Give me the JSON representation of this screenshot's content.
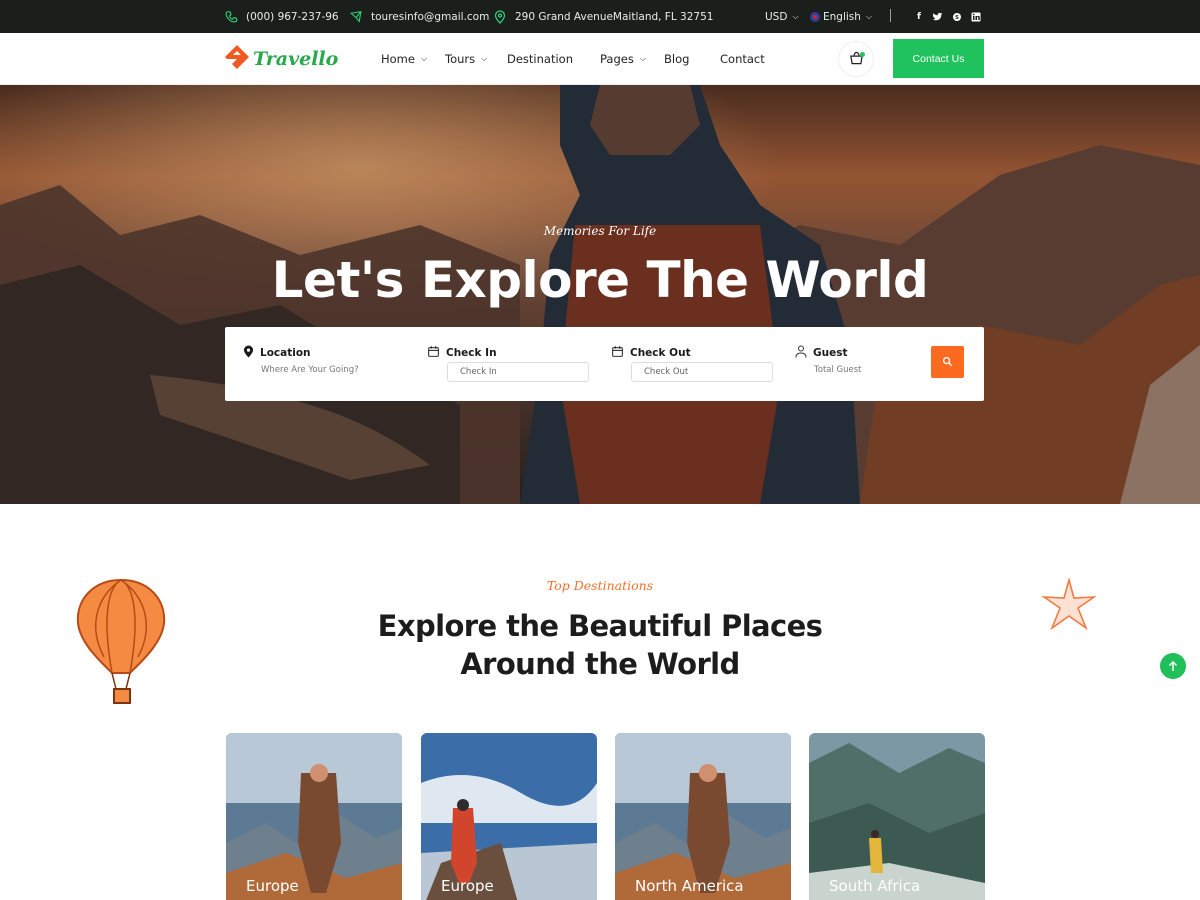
{
  "topbar": {
    "phone": "(000) 967-237-96",
    "email": "touresinfo@gmail.com",
    "address": "290 Grand AvenueMaitland, FL 32751",
    "currency": "USD",
    "language": "English",
    "social_icons": [
      "facebook-icon",
      "twitter-icon",
      "skype-icon",
      "linkedin-icon"
    ]
  },
  "header": {
    "logo_text": "Travello",
    "nav": [
      "Home",
      "Tours",
      "Destination",
      "Pages",
      "Blog",
      "Contact"
    ],
    "contact_button": "Contact Us"
  },
  "hero": {
    "subtitle": "Memories For Life",
    "title": "Let's Explore The World",
    "search": {
      "location_label": "Location",
      "location_placeholder": "Where Are Your Going?",
      "checkin_label": "Check In",
      "checkin_placeholder": "Check In",
      "checkout_label": "Check Out",
      "checkout_placeholder": "Check Out",
      "guest_label": "Guest",
      "guest_placeholder": "Total Guest"
    }
  },
  "destinations": {
    "subtitle": "Top Destinations",
    "title_line1": "Explore the Beautiful Places",
    "title_line2": "Around the World",
    "cards": [
      "Europe",
      "Europe",
      "North America",
      "South Africa"
    ]
  },
  "colors": {
    "accent_orange": "#fc6a1f",
    "accent_green": "#20c25e",
    "topbar_bg": "#1b1f1c"
  }
}
